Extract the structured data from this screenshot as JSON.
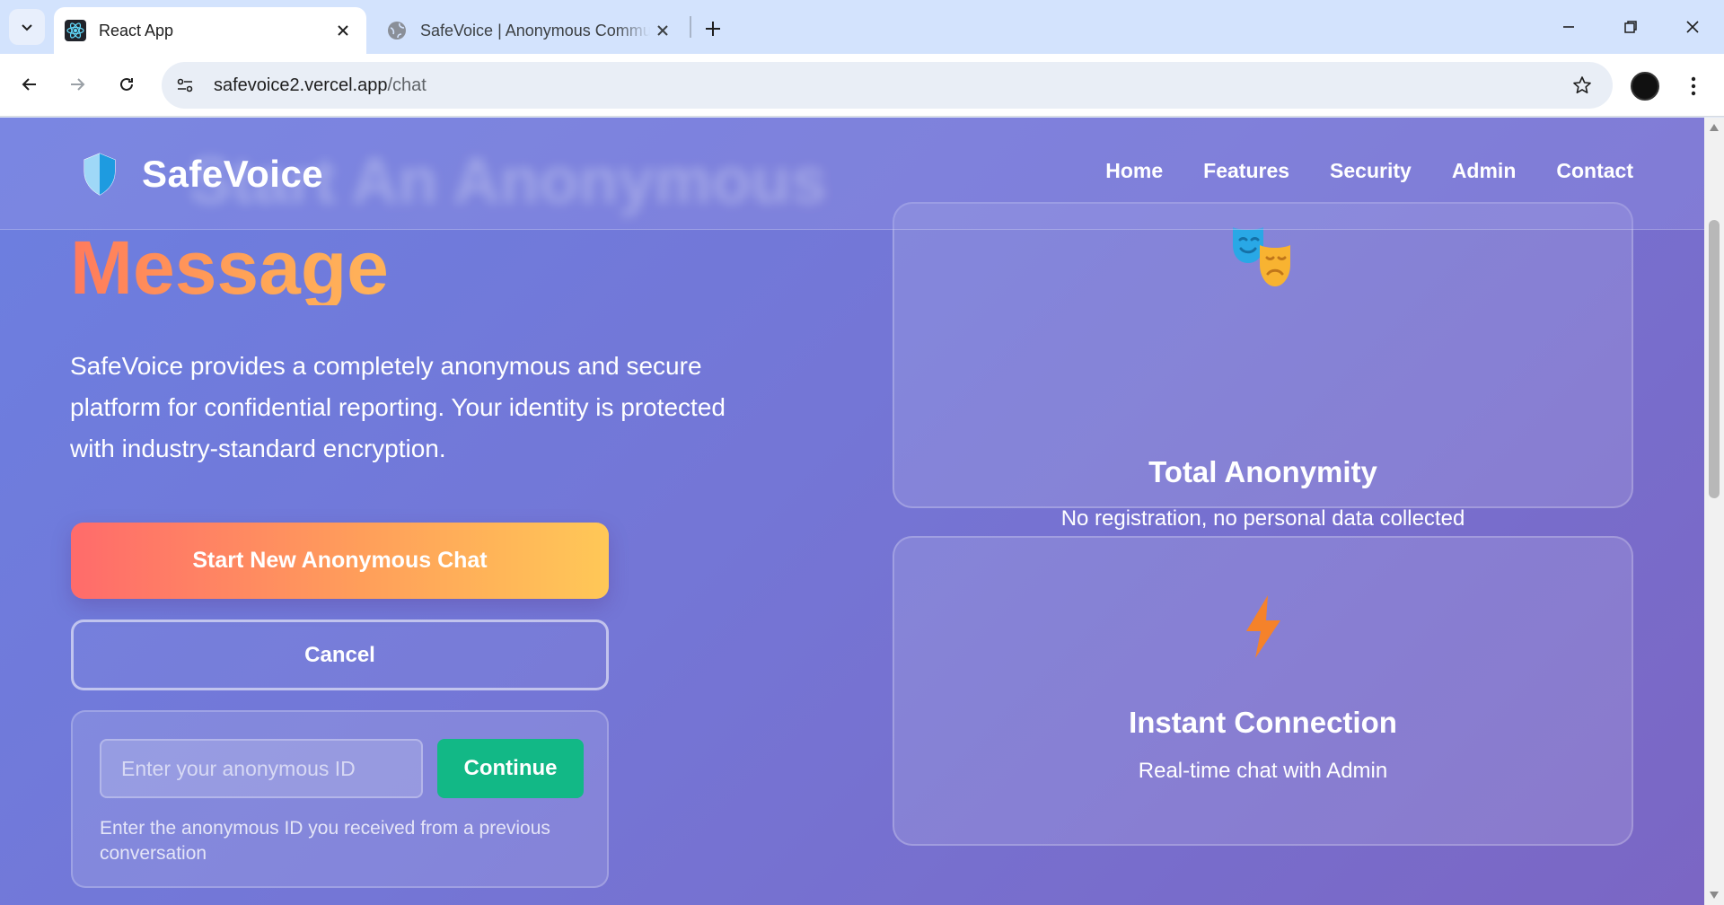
{
  "browser": {
    "tabs": [
      {
        "title": "React App",
        "favicon": "react-icon",
        "active": true
      },
      {
        "title": "SafeVoice | Anonymous Communication",
        "favicon": "globe-icon",
        "active": false
      }
    ],
    "address_url": "safevoice2.vercel.app",
    "address_path": "/chat"
  },
  "site": {
    "brand": "SafeVoice",
    "ghost_heading": "Start An Anonymous",
    "nav": [
      "Home",
      "Features",
      "Security",
      "Admin",
      "Contact"
    ]
  },
  "hero": {
    "heading_word": "Message",
    "description": "SafeVoice provides a completely anonymous and secure platform for confidential reporting. Your identity is protected with industry-standard encryption.",
    "primary_button": "Start New Anonymous Chat",
    "cancel_button": "Cancel",
    "resume": {
      "placeholder": "Enter your anonymous ID",
      "button": "Continue",
      "help": "Enter the anonymous ID you received from a previous conversation"
    }
  },
  "features": [
    {
      "icon": "theater-masks-icon",
      "title": "Total Anonymity",
      "description": "No registration, no personal data collected"
    },
    {
      "icon": "lightning-icon",
      "title": "Instant Connection",
      "description": "Real-time chat with Admin"
    }
  ],
  "colors": {
    "accent_gradient_start": "#ff6b6b",
    "accent_gradient_end": "#ffc857",
    "continue_green": "#12b886",
    "page_gradient": "#6c7fe0"
  }
}
